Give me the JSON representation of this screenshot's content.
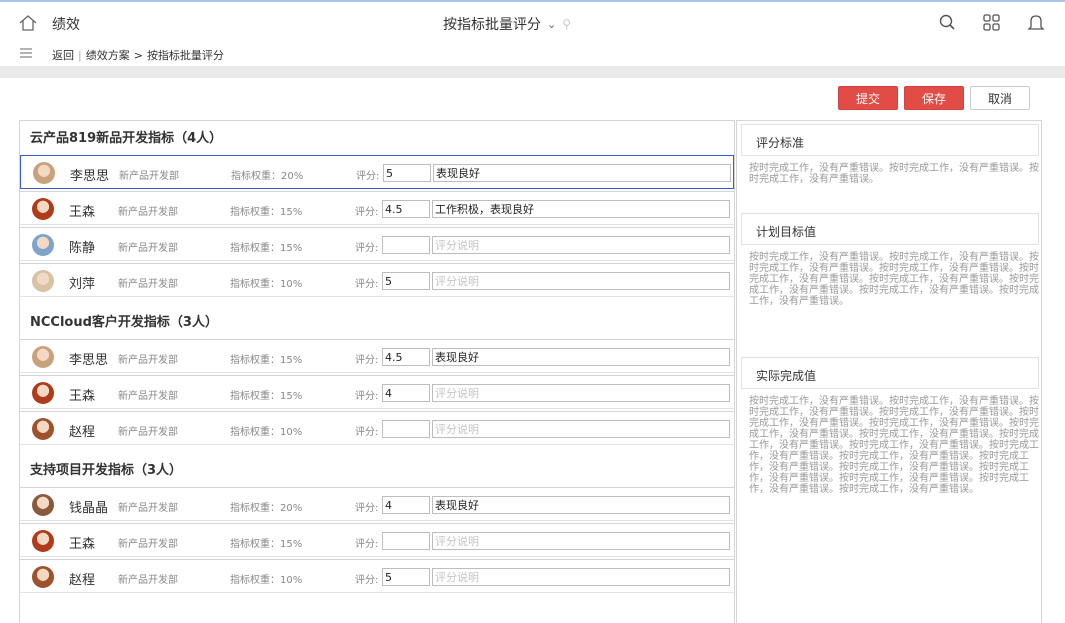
{
  "header": {
    "app_title": "绩效",
    "page_title": "按指标批量评分"
  },
  "breadcrumb": {
    "back": "返回",
    "plan": "绩效方案",
    "current": "按指标批量评分"
  },
  "actions": {
    "submit": "提交",
    "save": "保存",
    "cancel": "取消"
  },
  "labels": {
    "score": "评分:",
    "comment_placeholder": "评分说明"
  },
  "groups": [
    {
      "title": "云产品819新品开发指标（4人）",
      "rows": [
        {
          "name": "李思思",
          "dept": "新产品开发部",
          "weight": "指标权重：20%",
          "score": "5",
          "comment": "表现良好",
          "selected": true
        },
        {
          "name": "王森",
          "dept": "新产品开发部",
          "weight": "指标权重：15%",
          "score": "4.5",
          "comment": "工作积极，表现良好"
        },
        {
          "name": "陈静",
          "dept": "新产品开发部",
          "weight": "指标权重：15%",
          "score": "",
          "comment": ""
        },
        {
          "name": "刘萍",
          "dept": "新产品开发部",
          "weight": "指标权重：10%",
          "score": "5",
          "comment": ""
        }
      ]
    },
    {
      "title": "NCCloud客户开发指标（3人）",
      "rows": [
        {
          "name": "李思思",
          "dept": "新产品开发部",
          "weight": "指标权重：15%",
          "score": "4.5",
          "comment": "表现良好"
        },
        {
          "name": "王森",
          "dept": "新产品开发部",
          "weight": "指标权重：15%",
          "score": "4",
          "comment": ""
        },
        {
          "name": "赵程",
          "dept": "新产品开发部",
          "weight": "指标权重：10%",
          "score": "",
          "comment": ""
        }
      ]
    },
    {
      "title": "支持项目开发指标（3人）",
      "rows": [
        {
          "name": "钱晶晶",
          "dept": "新产品开发部",
          "weight": "指标权重：20%",
          "score": "4",
          "comment": "表现良好"
        },
        {
          "name": "王森",
          "dept": "新产品开发部",
          "weight": "指标权重：15%",
          "score": "",
          "comment": ""
        },
        {
          "name": "赵程",
          "dept": "新产品开发部",
          "weight": "指标权重：10%",
          "score": "5",
          "comment": ""
        }
      ]
    }
  ],
  "sidebar": {
    "criteria_title": "评分标准",
    "criteria_text": "按时完成工作，没有严重错误。按时完成工作，没有严重错误。按时完成工作，没有严重错误。",
    "target_title": "计划目标值",
    "target_text": "按时完成工作，没有严重错误。按时完成工作，没有严重错误。按时完成工作，没有严重错误。按时完成工作，没有严重错误。按时完成工作，没有严重错误。按时完成工作，没有严重错误。按时完成工作，没有严重错误。按时完成工作，没有严重错误。按时完成工作，没有严重错误。",
    "actual_title": "实际完成值",
    "actual_text": "按时完成工作，没有严重错误。按时完成工作，没有严重错误。按时完成工作，没有严重错误。按时完成工作，没有严重错误。按时完成工作，没有严重错误。按时完成工作，没有严重错误。按时完成工作，没有严重错误。按时完成工作，没有严重错误。按时完成工作，没有严重错误。按时完成工作，没有严重错误。按时完成工作，没有严重错误。按时完成工作，没有严重错误。按时完成工作，没有严重错误。按时完成工作，没有严重错误。按时完成工作，没有严重错误。按时完成工作，没有严重错误。按时完成工作，没有严重错误。按时完成工作，没有严重错误。"
  },
  "colors": {
    "primary_red": "#e14c46",
    "selected_border": "#3b5bd6"
  }
}
